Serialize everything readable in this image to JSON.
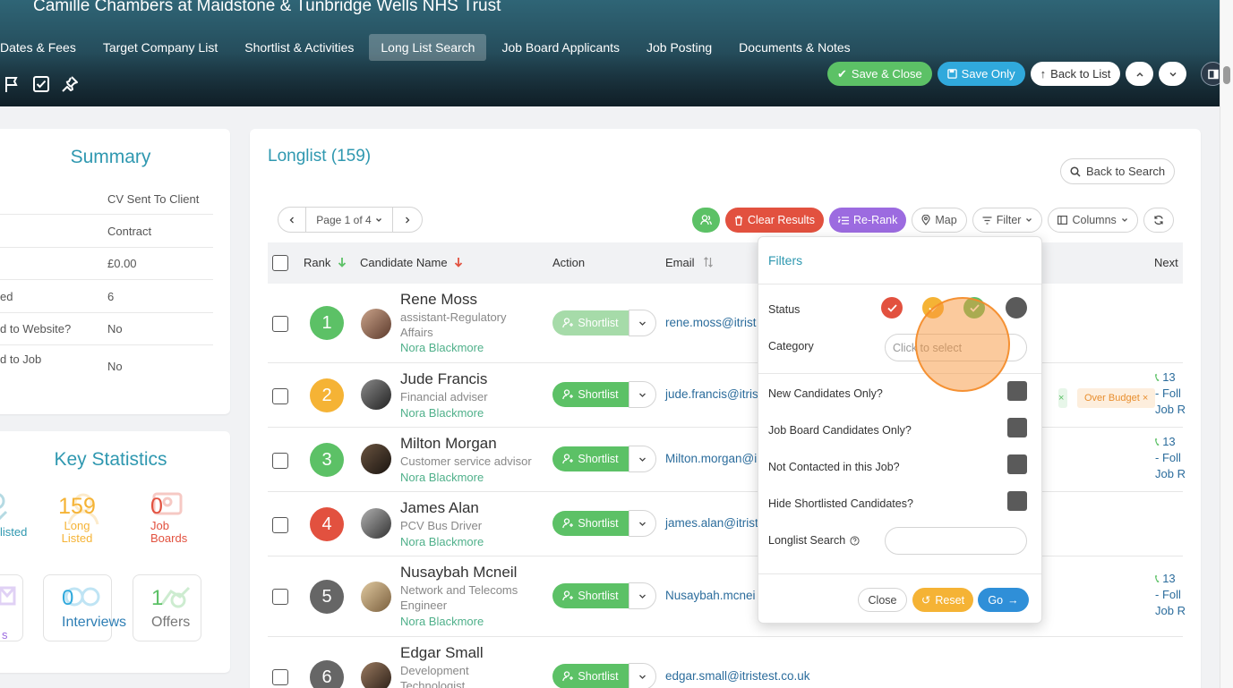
{
  "header": {
    "title": "Camille Chambers at Maidstone & Tunbridge Wells NHS Trust",
    "tabs": [
      {
        "label": "Dates & Fees"
      },
      {
        "label": "Target Company List"
      },
      {
        "label": "Shortlist & Activities"
      },
      {
        "label": "Long List Search"
      },
      {
        "label": "Job Board Applicants"
      },
      {
        "label": "Job Posting"
      },
      {
        "label": "Documents & Notes"
      }
    ],
    "active_tab": "Long List Search",
    "buttons": {
      "save_close": "Save & Close",
      "save_only": "Save Only",
      "back_to_list": "Back to List"
    }
  },
  "summary": {
    "title": "Summary",
    "rows": [
      {
        "key": "",
        "value": "CV Sent To Client"
      },
      {
        "key": "",
        "value": "Contract"
      },
      {
        "key": "",
        "value": "£0.00"
      },
      {
        "key": "ed",
        "value": "6"
      },
      {
        "key": "d to Website?",
        "value": "No"
      },
      {
        "key": "d to Job",
        "value": "No"
      }
    ]
  },
  "key_statistics": {
    "title": "Key Statistics",
    "long_listed": {
      "value": "159",
      "label1": "Long",
      "label2": "Listed"
    },
    "job_boards": {
      "value": "0",
      "label1": "Job",
      "label2": "Boards"
    },
    "shortlisted_partial": "listed",
    "interviews": {
      "value": "0",
      "label": "Interviews"
    },
    "offers": {
      "value": "1",
      "label": "Offers"
    },
    "partial_s": "s"
  },
  "longlist": {
    "title": "Longlist (159)",
    "back_to_search": "Back to Search",
    "page_label": "Page 1 of 4",
    "toolbar": {
      "clear_results": "Clear Results",
      "re_rank": "Re-Rank",
      "map": "Map",
      "filter": "Filter",
      "columns": "Columns"
    },
    "columns": {
      "rank": "Rank",
      "candidate_name": "Candidate Name",
      "action": "Action",
      "email": "Email",
      "next": "Next"
    },
    "shortlist_label": "Shortlist",
    "rows": [
      {
        "rank": "1",
        "name": "Rene Moss",
        "job_line1": "assistant-Regulatory",
        "job_line2": "Affairs",
        "owner": "Nora Blackmore",
        "email": "rene.moss@itrist",
        "next1": "",
        "next2": "",
        "next3": ""
      },
      {
        "rank": "2",
        "name": "Jude Francis",
        "job_line1": "Financial adviser",
        "job_line2": "",
        "owner": "Nora Blackmore",
        "email": "jude.francis@itris",
        "next1": "13",
        "next2": "- Foll",
        "next3": "Job R"
      },
      {
        "rank": "3",
        "name": "Milton Morgan",
        "job_line1": "Customer service advisor",
        "job_line2": "",
        "owner": "Nora Blackmore",
        "email": "Milton.morgan@i",
        "next1": "13",
        "next2": "- Foll",
        "next3": "Job R"
      },
      {
        "rank": "4",
        "name": "James Alan",
        "job_line1": "PCV Bus Driver",
        "job_line2": "",
        "owner": "Nora Blackmore",
        "email": "james.alan@itrist",
        "next1": "",
        "next2": "",
        "next3": ""
      },
      {
        "rank": "5",
        "name": "Nusaybah Mcneil",
        "job_line1": "Network and Telecoms",
        "job_line2": "Engineer",
        "owner": "Nora Blackmore",
        "email": "Nusaybah.mcnei",
        "next1": "13",
        "next2": "- Foll",
        "next3": "Job R"
      },
      {
        "rank": "6",
        "name": "Edgar Small",
        "job_line1": "Development",
        "job_line2": "Technologist",
        "owner": "",
        "email": "edgar.small@itristest.co.uk",
        "next1": "",
        "next2": "",
        "next3": ""
      }
    ],
    "tags": {
      "over_budget": "Over Budget",
      "close_x": "×"
    }
  },
  "filters": {
    "title": "Filters",
    "status_label": "Status",
    "category_label": "Category",
    "category_placeholder": "Click to select",
    "new_candidates": "New Candidates Only?",
    "job_board_candidates": "Job Board Candidates Only?",
    "not_contacted": "Not Contacted in this Job?",
    "hide_shortlisted": "Hide Shortlisted Candidates?",
    "longlist_search": "Longlist Search",
    "close": "Close",
    "reset": "Reset",
    "go": "Go"
  },
  "colors": {
    "accent_teal": "#2f98b0",
    "green": "#5cc166",
    "blue": "#30a9dc",
    "red": "#e2513f",
    "purple": "#9c6be0",
    "amber": "#f5b335",
    "grey_rank": "#666666",
    "owner_green": "#4fb08a",
    "link_blue": "#2b6c9c"
  }
}
